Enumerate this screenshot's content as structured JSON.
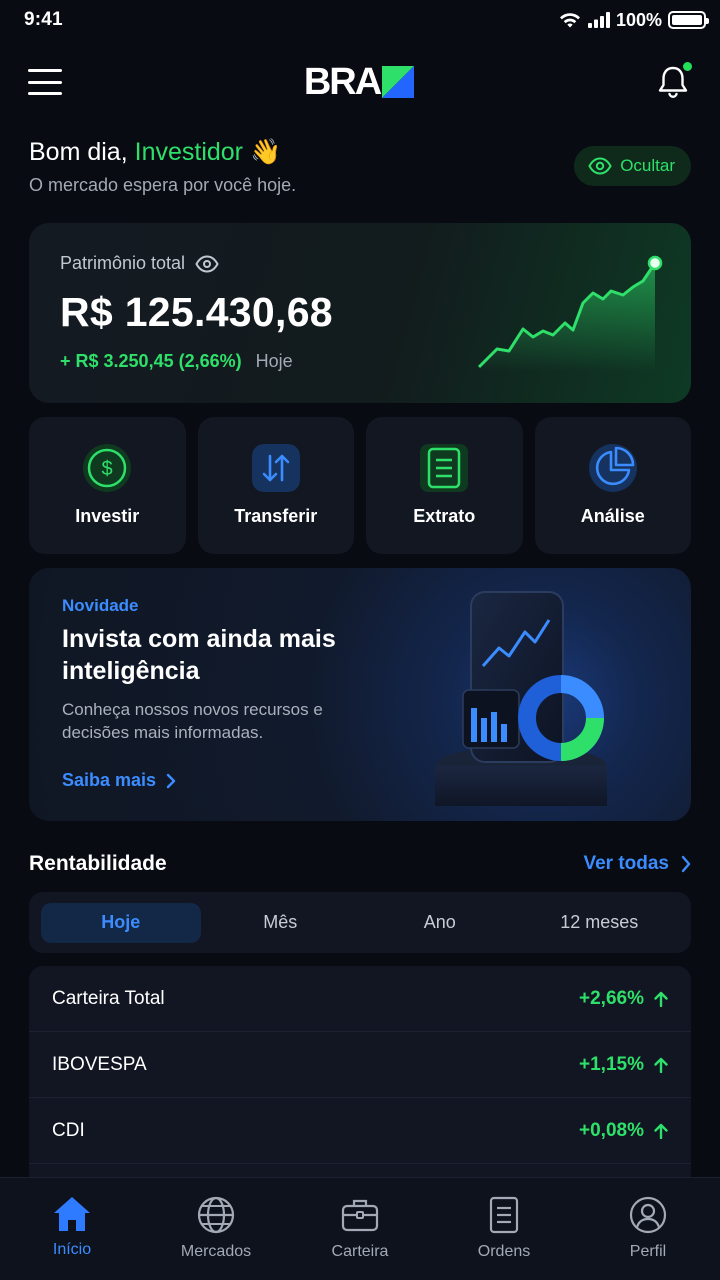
{
  "status": {
    "time": "9:41",
    "battery": "100%"
  },
  "header": {
    "logo": "BRA",
    "menu_icon": "hamburger-icon",
    "notification_icon": "bell-icon"
  },
  "greeting": {
    "prefix": "Bom dia,",
    "name": "Investidor",
    "emoji": "👋",
    "subtitle": "O mercado espera por você hoje.",
    "hide_label": "Ocultar"
  },
  "balance": {
    "label": "Patrimônio total",
    "value": "R$ 125.430,68",
    "change": "+ R$ 3.250,45 (2,66%)",
    "period": "Hoje"
  },
  "actions": [
    {
      "label": "Investir",
      "icon": "dollar-icon",
      "color": "#2ee06a"
    },
    {
      "label": "Transferir",
      "icon": "transfer-icon",
      "color": "#3b8cff"
    },
    {
      "label": "Extrato",
      "icon": "document-icon",
      "color": "#2ee06a"
    },
    {
      "label": "Análise",
      "icon": "pie-chart-icon",
      "color": "#3b8cff"
    }
  ],
  "promo": {
    "tag": "Novidade",
    "title": "Invista com ainda mais inteligência",
    "description": "Conheça nossos novos recursos e decisões mais informadas.",
    "link": "Saiba mais"
  },
  "performance": {
    "title": "Rentabilidade",
    "see_all": "Ver todas",
    "tabs": [
      "Hoje",
      "Mês",
      "Ano",
      "12 meses"
    ],
    "active_tab": "Hoje",
    "rows": [
      {
        "name": "Carteira Total",
        "value": "+2,66%"
      },
      {
        "name": "IBOVESPA",
        "value": "+1,15%"
      },
      {
        "name": "CDI",
        "value": "+0,08%"
      }
    ]
  },
  "nav": [
    {
      "label": "Início",
      "icon": "home-icon",
      "active": true
    },
    {
      "label": "Mercados",
      "icon": "globe-icon",
      "active": false
    },
    {
      "label": "Carteira",
      "icon": "briefcase-icon",
      "active": false
    },
    {
      "label": "Ordens",
      "icon": "list-icon",
      "active": false
    },
    {
      "label": "Perfil",
      "icon": "user-icon",
      "active": false
    }
  ],
  "colors": {
    "accent_green": "#2ee06a",
    "accent_blue": "#3b8cff",
    "background": "#080b12"
  }
}
